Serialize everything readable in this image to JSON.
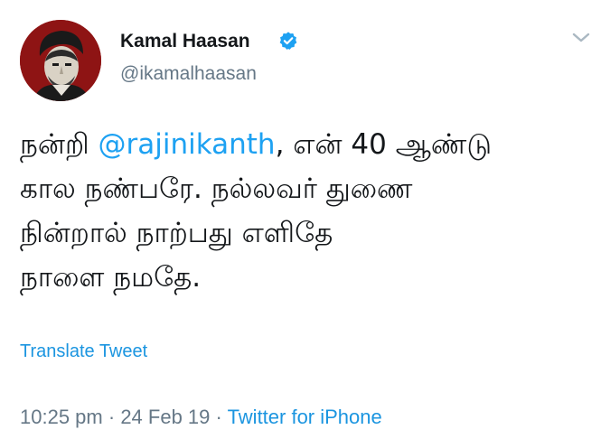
{
  "user": {
    "display_name": "Kamal Haasan",
    "handle": "@ikamalhaasan",
    "verified": true,
    "avatar_icon": "portrait-avatar-icon"
  },
  "tweet": {
    "lines": [
      {
        "before": "நன்றி ",
        "mention": "@rajinikanth",
        "after": ", என் 40 ஆண்டு"
      },
      {
        "text": "கால நண்பரே. நல்லவர் துணை"
      },
      {
        "text": "நின்றால் நாற்பது எளிதே"
      },
      {
        "text": "நாளை நமதே."
      }
    ]
  },
  "actions": {
    "translate_label": "Translate Tweet"
  },
  "meta": {
    "time": "10:25 pm",
    "date": "24 Feb 19",
    "separator": "·",
    "source": "Twitter for iPhone"
  },
  "colors": {
    "link": "#1da1f2",
    "muted": "#657786",
    "text": "#14171a",
    "verified": "#1da1f2"
  }
}
